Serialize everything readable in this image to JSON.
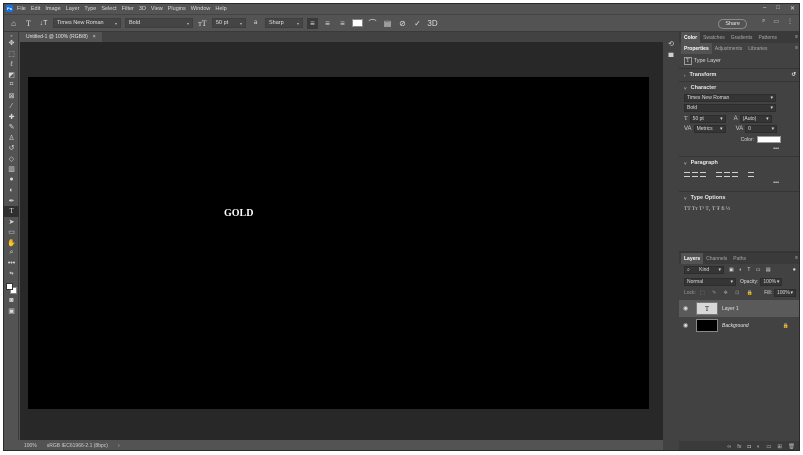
{
  "menu": {
    "logo": "Ps",
    "items": [
      "File",
      "Edit",
      "Image",
      "Layer",
      "Type",
      "Select",
      "Filter",
      "3D",
      "View",
      "Plugins",
      "Window",
      "Help"
    ]
  },
  "options": {
    "font_family": "Times New Roman",
    "font_style": "Bold",
    "font_size": "50 pt",
    "aa_label": "a",
    "antialias": "Sharp",
    "share": "Share"
  },
  "document": {
    "tab_title": "Untitled-1 @ 100% (RGB/8)",
    "tab_close": "×",
    "canvas_text": "GOLD"
  },
  "status": {
    "zoom": "100%",
    "profile": "sRGB IEC61966-2.1 (8bpc)",
    "arrow": "›"
  },
  "panels": {
    "top_tabs": [
      "Color",
      "Swatches",
      "Gradients",
      "Patterns"
    ],
    "prop_tabs": [
      "Properties",
      "Adjustments",
      "Libraries"
    ],
    "type_layer": "Type Layer",
    "transform": "Transform",
    "character": "Character",
    "char_font": "Times New Roman",
    "char_style": "Bold",
    "char_size": "50 pt",
    "leading": "(Auto)",
    "kerning": "Metrics",
    "tracking": "0",
    "color_label": "Color:",
    "more": "•••",
    "paragraph": "Paragraph",
    "type_options": "Type Options",
    "type_option_glyphs": "TT  Tт  T¹  T₁  T  Ŧ  fi  ½"
  },
  "layers": {
    "tabs": [
      "Layers",
      "Channels",
      "Paths"
    ],
    "filter": "Kind",
    "blend_mode": "Normal",
    "opacity_label": "Opacity:",
    "opacity": "100%",
    "lock_label": "Lock:",
    "fill_label": "Fill:",
    "fill": "100%",
    "items": [
      {
        "name": "Layer 1",
        "thumb": "T"
      },
      {
        "name": "Background",
        "thumb": ""
      }
    ]
  },
  "colors": {
    "canvas": "#000000",
    "chrome": "#535353",
    "text_fill": "#ffffff"
  }
}
